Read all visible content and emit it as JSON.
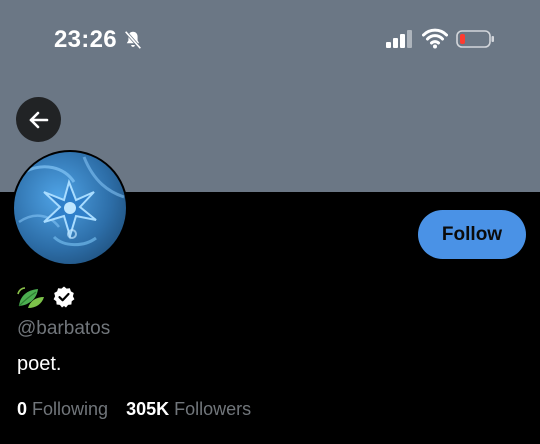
{
  "status_bar": {
    "time": "23:26",
    "silent_icon": "bell-slash-icon",
    "signal_icon": "cellular-signal-icon",
    "wifi_icon": "wifi-icon",
    "battery_icon": "battery-low-icon",
    "battery_color": "#ff3b30"
  },
  "header": {
    "back_icon": "arrow-left-icon",
    "banner_color": "#6b7785"
  },
  "profile": {
    "avatar_icon": "blue-flower-avatar",
    "name_emoji": "leaves-emoji",
    "verified_icon": "verified-badge-icon",
    "handle": "@barbatos",
    "bio": "poet.",
    "follow_label": "Follow",
    "accent_color": "#4a92e6"
  },
  "stats": {
    "following_count": "0",
    "following_label": "Following",
    "followers_count": "305K",
    "followers_label": "Followers"
  }
}
